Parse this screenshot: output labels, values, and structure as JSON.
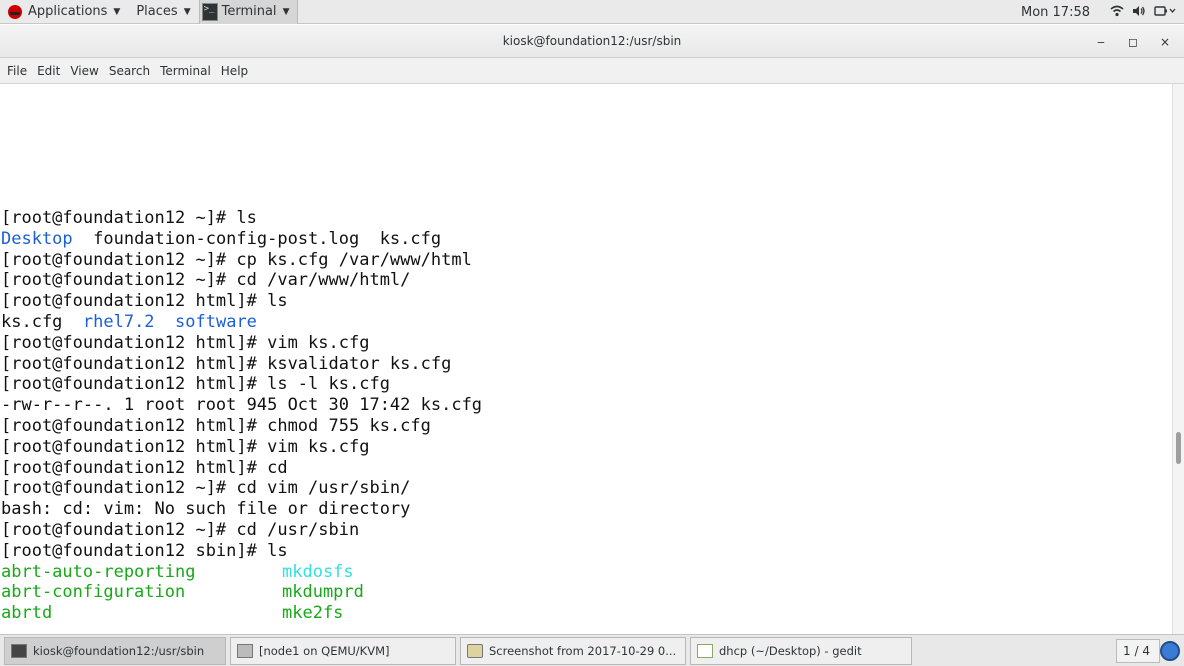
{
  "top_panel": {
    "applications": "Applications",
    "places": "Places",
    "terminal": "Terminal",
    "clock": "Mon 17:58",
    "icons": [
      "redhat-logo",
      "wifi-icon",
      "volume-icon",
      "power-icon"
    ]
  },
  "window": {
    "title": "kiosk@foundation12:/usr/sbin",
    "minimize": "‒",
    "maximize": "◻",
    "close": "×"
  },
  "menubar": [
    "File",
    "Edit",
    "View",
    "Search",
    "Terminal",
    "Help"
  ],
  "terminal": {
    "lines": [
      {
        "text": "[root@foundation12 ~]# ls"
      },
      {
        "parts": [
          {
            "text": "Desktop",
            "color": "blue"
          },
          {
            "text": "  foundation-config-post.log  ks.cfg"
          }
        ]
      },
      {
        "text": "[root@foundation12 ~]# cp ks.cfg /var/www/html"
      },
      {
        "text": "[root@foundation12 ~]# cd /var/www/html/"
      },
      {
        "text": "[root@foundation12 html]# ls"
      },
      {
        "parts": [
          {
            "text": "ks.cfg  "
          },
          {
            "text": "rhel7.2",
            "color": "blue"
          },
          {
            "text": "  "
          },
          {
            "text": "software",
            "color": "blue"
          }
        ]
      },
      {
        "text": "[root@foundation12 html]# vim ks.cfg"
      },
      {
        "text": "[root@foundation12 html]# ksvalidator ks.cfg"
      },
      {
        "text": "[root@foundation12 html]# ls -l ks.cfg"
      },
      {
        "text": "-rw-r--r--. 1 root root 945 Oct 30 17:42 ks.cfg"
      },
      {
        "text": "[root@foundation12 html]# chmod 755 ks.cfg"
      },
      {
        "text": "[root@foundation12 html]# vim ks.cfg"
      },
      {
        "text": "[root@foundation12 html]# cd"
      },
      {
        "text": "[root@foundation12 ~]# cd vim /usr/sbin/"
      },
      {
        "text": "bash: cd: vim: No such file or directory"
      },
      {
        "text": "[root@foundation12 ~]# cd /usr/sbin"
      },
      {
        "text": "[root@foundation12 sbin]# ls"
      }
    ],
    "listing": [
      {
        "left": "abrt-auto-reporting",
        "right": "mkdosfs",
        "right_color": "cyan"
      },
      {
        "left": "abrt-configuration",
        "right": "mkdumprd",
        "right_color": "green"
      },
      {
        "left": "abrtd",
        "right": "mke2fs",
        "right_color": "green"
      }
    ]
  },
  "taskbar": {
    "tasks": [
      {
        "label": "kiosk@foundation12:/usr/sbin",
        "icon": "terminal-icon",
        "active": true
      },
      {
        "label": "[node1 on QEMU/KVM]",
        "icon": "vm-icon",
        "active": false
      },
      {
        "label": "Screenshot from 2017-10-29 0...",
        "icon": "screenshot-icon",
        "active": false
      },
      {
        "label": "dhcp (~/Desktop) - gedit",
        "icon": "gedit-icon",
        "active": false
      }
    ],
    "workspace": "1 / 4"
  }
}
